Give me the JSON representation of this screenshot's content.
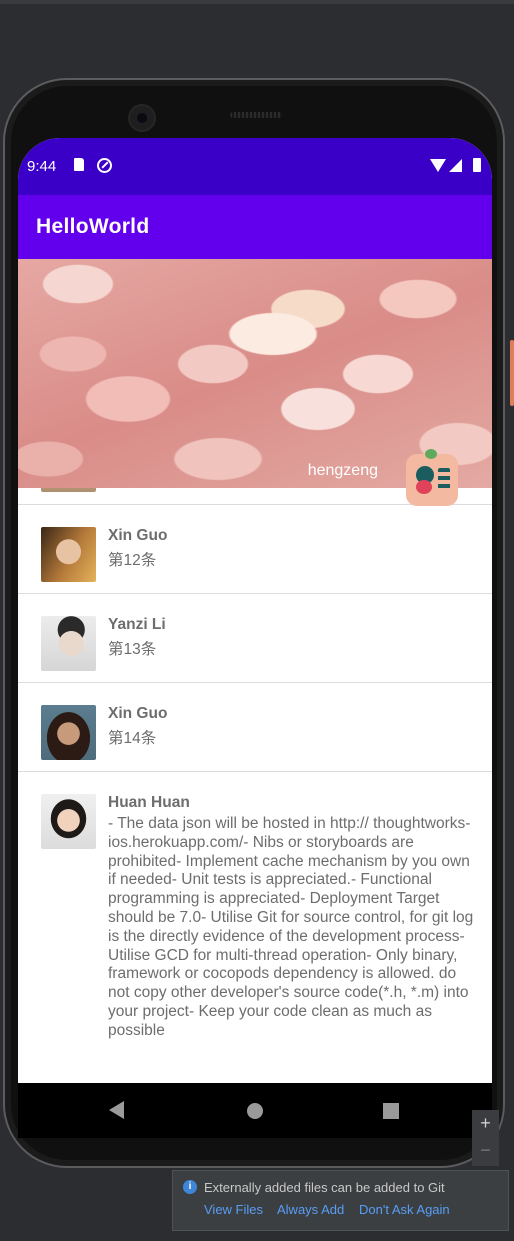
{
  "status_bar": {
    "time": "9:44"
  },
  "app_bar": {
    "title": "HelloWorld"
  },
  "banner": {
    "caption": "hengzeng"
  },
  "list": {
    "items": [
      {
        "name": "Xin Guo",
        "subtitle": "第12条"
      },
      {
        "name": "Yanzi Li",
        "subtitle": "第13条"
      },
      {
        "name": "Xin Guo",
        "subtitle": "第14条"
      },
      {
        "name": "Huan Huan",
        "subtitle": "- The data json will be hosted in http:// thoughtworks-ios.herokuapp.com/- Nibs or storyboards are prohibited- Implement cache mechanism by you own if needed- Unit tests is appreciated.- Functional programming is appreciated- Deployment Target should be 7.0- Utilise Git for source control, for git log is the directly evidence of the development process- Utilise GCD for multi-thread operation- Only binary, framework or cocopods dependency is allowed. do not copy other developer's source code(*.h, *.m) into your project- Keep your code clean as much as possible"
      }
    ]
  },
  "zoom": {
    "in": "+",
    "out": "−"
  },
  "notification": {
    "icon": "info-icon",
    "message": "Externally added files can be added to Git",
    "actions": [
      "View Files",
      "Always Add",
      "Don't Ask Again"
    ]
  },
  "colors": {
    "status_bar": "#3b00c8",
    "app_bar": "#6200ee",
    "link": "#589df6"
  }
}
